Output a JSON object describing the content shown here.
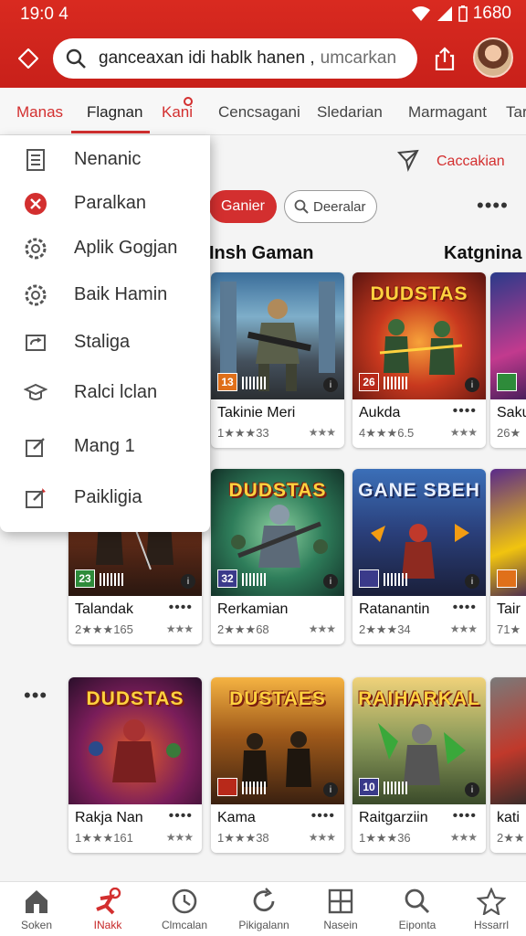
{
  "status_bar": {
    "time": "19:0 4",
    "battery": "1680"
  },
  "header": {
    "search_query": "ganceaxan idi hablk hanen ,",
    "search_placeholder": "umcarkan"
  },
  "tabs": [
    {
      "label": "Manas",
      "state": "red"
    },
    {
      "label": "Flagnan",
      "state": "active"
    },
    {
      "label": "Kani",
      "state": "red"
    },
    {
      "label": "Cencsagani",
      "state": "normal"
    },
    {
      "label": "Sledarian",
      "state": "normal"
    },
    {
      "label": "Marmagant",
      "state": "normal"
    },
    {
      "label": "Tar",
      "state": "normal"
    }
  ],
  "dropdown_menu": {
    "items": [
      {
        "label": "Nenanic",
        "icon": "document-icon"
      },
      {
        "label": "Paralkan",
        "icon": "close-circle-icon"
      },
      {
        "label": "Aplik Gogjan",
        "icon": "gear-icon"
      },
      {
        "label": "Baik Hamin",
        "icon": "gear-icon"
      },
      {
        "label": "Staliga",
        "icon": "repeat-icon"
      },
      {
        "label": "Ralci lclan",
        "icon": "graduation-cap-icon"
      },
      {
        "label": "Mang 1",
        "icon": "edit-icon"
      },
      {
        "label": "Paikligia",
        "icon": "edit-icon"
      }
    ]
  },
  "filters": {
    "explore_label": "Caccakian",
    "active_chip": "Ganier",
    "search_chip": "Deeralar"
  },
  "sections": {
    "left_title": "Insh Gaman",
    "right_title": "Katgnina"
  },
  "games": [
    {
      "name": "Takinie Meri",
      "rating": "1★★★33",
      "badge": "13",
      "art_title": ""
    },
    {
      "name": "Aukda",
      "rating": "4★★★6.5",
      "badge": "26",
      "art_title": "DUDSTAS"
    },
    {
      "name": "Saku",
      "rating": "26★",
      "badge": "",
      "art_title": ""
    },
    {
      "name": "Talandak",
      "rating": "2★★★165",
      "badge": "23",
      "art_title": ""
    },
    {
      "name": "Rerkamian",
      "rating": "2★★★68",
      "badge": "32",
      "art_title": "DUDSTAS"
    },
    {
      "name": "Ratanantin",
      "rating": "2★★★34",
      "badge": "",
      "art_title": "GANE SBEH"
    },
    {
      "name": "Tair",
      "rating": "71★",
      "badge": "",
      "art_title": ""
    },
    {
      "name": "Rakja Nan",
      "rating": "1★★★161",
      "badge": "",
      "art_title": "DUDSTAS"
    },
    {
      "name": "Kama",
      "rating": "1★★★38",
      "badge": "",
      "art_title": "DUSTAES"
    },
    {
      "name": "Raitgarziin",
      "rating": "1★★★36",
      "badge": "10",
      "art_title": "RAIHARKAL"
    },
    {
      "name": "kati",
      "rating": "2★★",
      "badge": "",
      "art_title": ""
    }
  ],
  "bottom_nav": [
    {
      "label": "Soken",
      "icon": "home-icon",
      "active": false
    },
    {
      "label": "INakk",
      "icon": "runner-icon",
      "active": true
    },
    {
      "label": "Clmcalan",
      "icon": "clock-icon",
      "active": false
    },
    {
      "label": "Pikigalann",
      "icon": "refresh-icon",
      "active": false
    },
    {
      "label": "Nasein",
      "icon": "grid-icon",
      "active": false
    },
    {
      "label": "Eiponta",
      "icon": "search-icon",
      "active": false
    },
    {
      "label": "Hssarrl",
      "icon": "star-icon",
      "active": false
    }
  ],
  "colors": {
    "brand_red": "#d32f2f",
    "topbar": "#c8201a"
  }
}
